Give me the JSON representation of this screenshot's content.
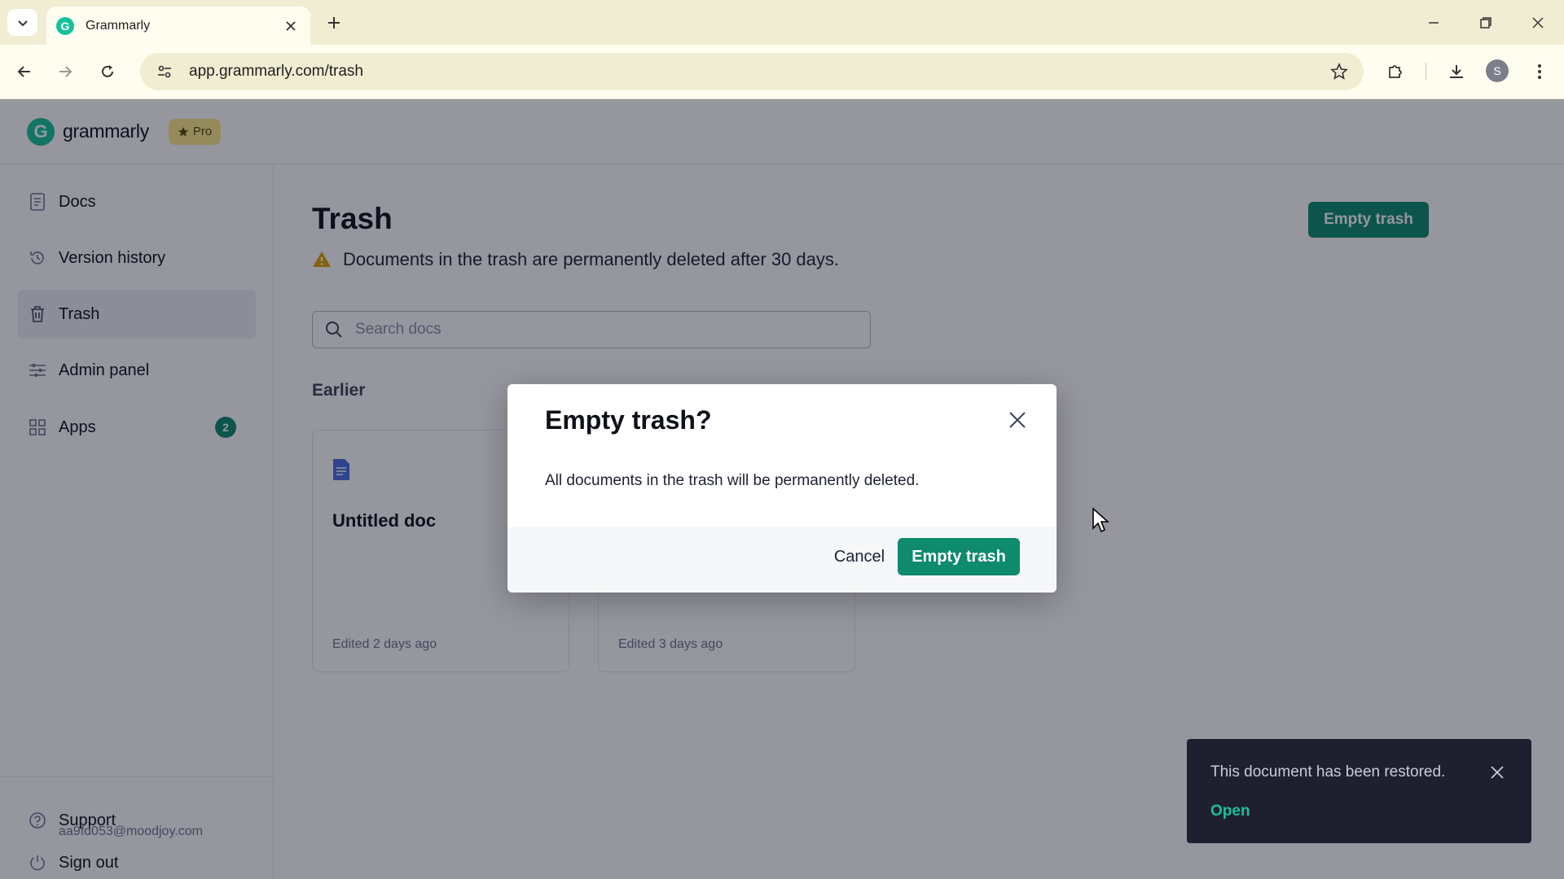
{
  "browser": {
    "tab_title": "Grammarly",
    "url": "app.grammarly.com/trash",
    "profile_initial": "S"
  },
  "app": {
    "logo_text": "grammarly",
    "pro_label": "Pro"
  },
  "sidebar": {
    "items": [
      {
        "label": "Docs"
      },
      {
        "label": "Version history"
      },
      {
        "label": "Trash"
      },
      {
        "label": "Admin panel"
      },
      {
        "label": "Apps",
        "badge": "2"
      }
    ],
    "support_label": "Support",
    "signout_label": "Sign out",
    "email": "aa9fd053@moodjoy.com"
  },
  "main": {
    "title": "Trash",
    "notice": "Documents in the trash are permanently deleted after 30 days.",
    "empty_trash_label": "Empty trash",
    "search_placeholder": "Search docs",
    "section_label": "Earlier",
    "docs": [
      {
        "title": "Untitled doc",
        "meta": "Edited 2 days ago"
      },
      {
        "title": "",
        "meta": "Edited 3 days ago"
      }
    ]
  },
  "dialog": {
    "title": "Empty trash?",
    "body": "All documents in the trash will be permanently deleted.",
    "cancel_label": "Cancel",
    "confirm_label": "Empty trash"
  },
  "toast": {
    "message": "This document has been restored.",
    "action_label": "Open"
  },
  "colors": {
    "brand_green": "#15c39a",
    "button_green": "#0e8a6d",
    "pro_yellow": "#ffe98a",
    "warning": "#e0a100"
  }
}
